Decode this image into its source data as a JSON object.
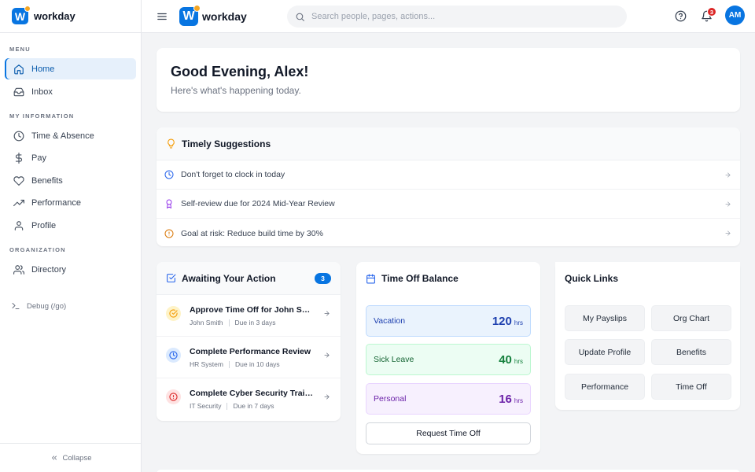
{
  "app": {
    "brand": "workday",
    "logo_letter": "W"
  },
  "sidebar": {
    "sections": {
      "menu": "MENU",
      "my_information": "MY INFORMATION",
      "organization": "ORGANIZATION"
    },
    "items": [
      {
        "label": "Home",
        "icon": "home-icon",
        "active": true
      },
      {
        "label": "Inbox",
        "icon": "inbox-icon"
      },
      {
        "label": "Time & Absence",
        "icon": "clock-icon"
      },
      {
        "label": "Pay",
        "icon": "dollar-icon"
      },
      {
        "label": "Benefits",
        "icon": "heart-icon"
      },
      {
        "label": "Performance",
        "icon": "trending-up-icon"
      },
      {
        "label": "Profile",
        "icon": "user-icon"
      },
      {
        "label": "Directory",
        "icon": "users-icon"
      }
    ],
    "debug_label": "Debug (/go)",
    "collapse_label": "Collapse"
  },
  "topbar": {
    "search_placeholder": "Search people, pages, actions...",
    "notification_count": "3",
    "avatar_initials": "AM"
  },
  "welcome": {
    "greeting": "Good Evening, Alex!",
    "subtitle": "Here's what's happening today."
  },
  "suggestions": {
    "title": "Timely Suggestions",
    "items": [
      {
        "text": "Don't forget to clock in today",
        "icon": "clock-icon",
        "color": "#2563eb"
      },
      {
        "text": "Self-review due for 2024 Mid-Year Review",
        "icon": "award-icon",
        "color": "#9333ea"
      },
      {
        "text": "Goal at risk: Reduce build time by 30%",
        "icon": "alert-circle-icon",
        "color": "#d97706"
      }
    ]
  },
  "awaiting": {
    "title": "Awaiting Your Action",
    "count": "3",
    "tasks": [
      {
        "title": "Approve Time Off for John Smith",
        "source": "John Smith",
        "due": "Due in 3 days",
        "icon": "check-circle-icon",
        "color": "#f59e0b",
        "bg": "#fef3c7"
      },
      {
        "title": "Complete Performance Review",
        "source": "HR System",
        "due": "Due in 10 days",
        "icon": "clock-icon",
        "color": "#2563eb",
        "bg": "#dbeafe"
      },
      {
        "title": "Complete Cyber Security Training",
        "source": "IT Security",
        "due": "Due in 7 days",
        "icon": "alert-circle-icon",
        "color": "#dc2626",
        "bg": "#fee2e2"
      }
    ]
  },
  "time_off": {
    "title": "Time Off Balance",
    "balances": [
      {
        "label": "Vacation",
        "value": "120",
        "unit": "hrs",
        "color": "#1e40af",
        "bg": "#eaf3fd",
        "border": "#bfdbfe"
      },
      {
        "label": "Sick Leave",
        "value": "40",
        "unit": "hrs",
        "color": "#15803d",
        "bg": "#ecfdf3",
        "border": "#bbf7d0"
      },
      {
        "label": "Personal",
        "value": "16",
        "unit": "hrs",
        "color": "#6b21a8",
        "bg": "#f7f0fe",
        "border": "#e9d5ff"
      }
    ],
    "request_label": "Request Time Off"
  },
  "quick_links": {
    "title": "Quick Links",
    "links": [
      "My Payslips",
      "Org Chart",
      "Update Profile",
      "Benefits",
      "Performance",
      "Time Off"
    ]
  }
}
